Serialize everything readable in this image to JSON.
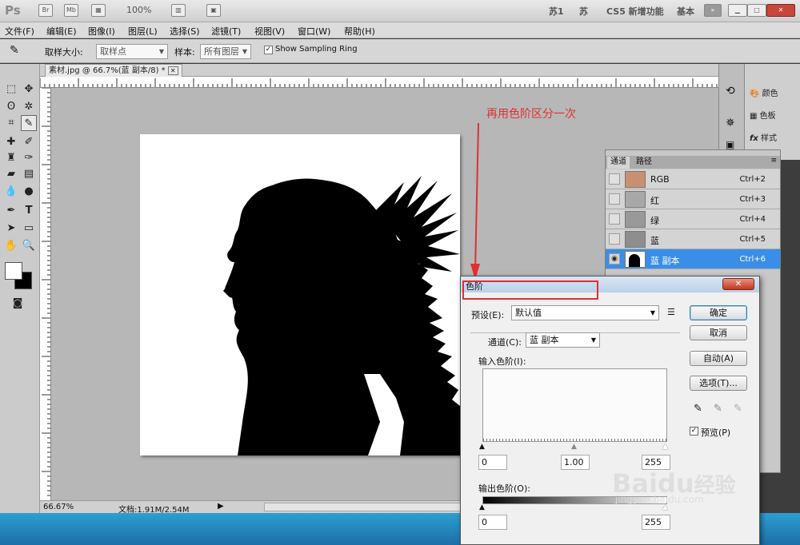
{
  "appbar": {
    "logo": "Ps",
    "zoom": "100%",
    "workspaces": [
      "苏1",
      "苏",
      "CS5 新增功能",
      "基本"
    ]
  },
  "menu": [
    "文件(F)",
    "编辑(E)",
    "图像(I)",
    "图层(L)",
    "选择(S)",
    "滤镜(T)",
    "视图(V)",
    "窗口(W)",
    "帮助(H)"
  ],
  "options": {
    "sample_size_label": "取样大小:",
    "sample_size_value": "取样点",
    "sample_label": "样本:",
    "sample_value": "所有图层",
    "show_ring": "Show Sampling Ring"
  },
  "document": {
    "tab_title": "素材.jpg @ 66.7%(蓝 副本/8) *",
    "zoom": "66.67%",
    "doc_info": "文档:1.91M/2.54M"
  },
  "dock": {
    "items": [
      "颜色",
      "色板",
      "样式"
    ]
  },
  "channels": {
    "tabs": [
      "通道",
      "路径"
    ],
    "rows": [
      {
        "name": "RGB",
        "key": "Ctrl+2"
      },
      {
        "name": "红",
        "key": "Ctrl+3"
      },
      {
        "name": "绿",
        "key": "Ctrl+4"
      },
      {
        "name": "蓝",
        "key": "Ctrl+5"
      },
      {
        "name": "蓝 副本",
        "key": "Ctrl+6"
      }
    ]
  },
  "annotation": "再用色阶区分一次",
  "levels": {
    "title": "色阶",
    "preset_label": "预设(E):",
    "preset_value": "默认值",
    "channel_label": "通道(C):",
    "channel_value": "蓝 副本",
    "input_label": "输入色阶(I):",
    "in_black": "0",
    "in_gamma": "1.00",
    "in_white": "255",
    "output_label": "输出色阶(O):",
    "out_black": "0",
    "out_white": "255",
    "ok": "确定",
    "cancel": "取消",
    "auto": "自动(A)",
    "options": "选项(T)...",
    "preview": "预览(P)"
  },
  "watermark": {
    "brand": "Baidu",
    "cn": "经验",
    "url": "jingyan.baidu.com"
  }
}
